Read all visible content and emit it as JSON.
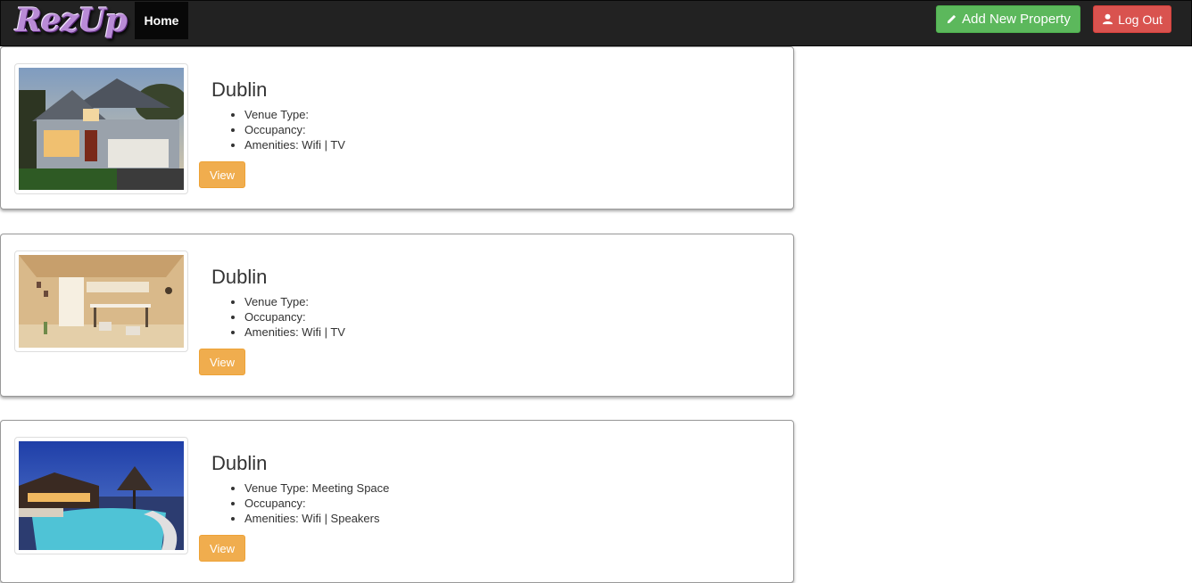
{
  "navbar": {
    "brand": "RezUp",
    "home_label": "Home",
    "add_property_label": "Add New Property",
    "logout_label": "Log Out"
  },
  "listings": [
    {
      "city": "Dublin",
      "venue_type": "Venue Type:",
      "occupancy": "Occupancy:",
      "amenities": "Amenities: Wifi | TV",
      "view_label": "View",
      "image": "house exterior"
    },
    {
      "city": "Dublin",
      "venue_type": "Venue Type:",
      "occupancy": "Occupancy:",
      "amenities": "Amenities: Wifi | TV",
      "view_label": "View",
      "image": "wooden cabin interior"
    },
    {
      "city": "Dublin",
      "venue_type": "Venue Type: Meeting Space",
      "occupancy": "Occupancy:",
      "amenities": "Amenities: Wifi | Speakers",
      "view_label": "View",
      "image": "resort pool at dusk"
    }
  ],
  "colors": {
    "navbar_bg": "#222222",
    "add_button": "#5cb85c",
    "logout_button": "#d9534f",
    "view_button": "#f0ad4e"
  }
}
